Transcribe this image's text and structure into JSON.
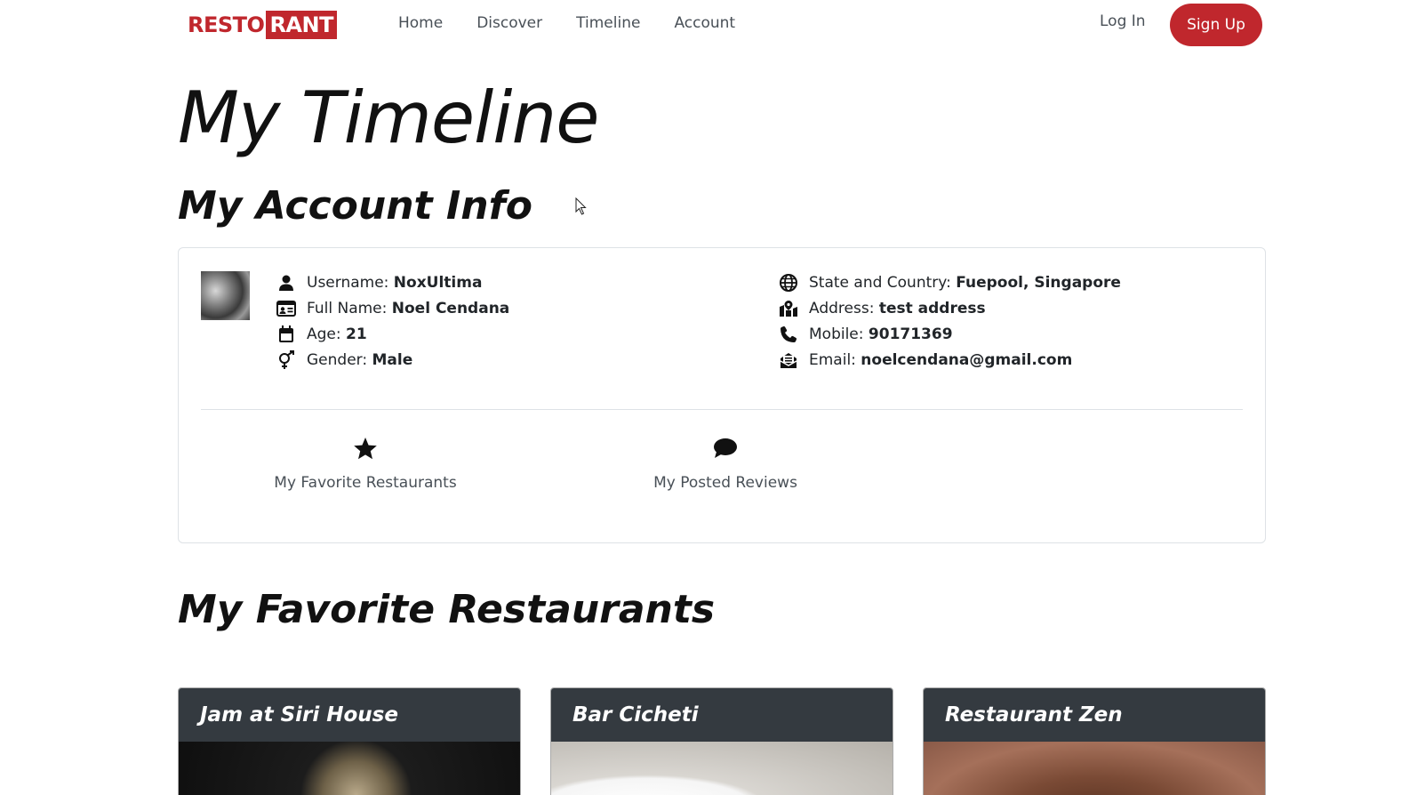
{
  "nav": {
    "logo_part1": "RESTO",
    "logo_part2": "RANT",
    "links": [
      "Home",
      "Discover",
      "Timeline",
      "Account"
    ],
    "login": "Log In",
    "signup": "Sign Up"
  },
  "page": {
    "title": "My Timeline",
    "account_section_title": "My Account Info",
    "favorites_section_title": "My Favorite Restaurants"
  },
  "account": {
    "left": [
      {
        "label": "Username: ",
        "value": "NoxUltima",
        "icon": "user-icon"
      },
      {
        "label": "Full Name: ",
        "value": "Noel Cendana",
        "icon": "id-card-icon"
      },
      {
        "label": "Age: ",
        "value": "21",
        "icon": "calendar-icon"
      },
      {
        "label": "Gender: ",
        "value": "Male",
        "icon": "gender-icon"
      }
    ],
    "right": [
      {
        "label": "State and Country: ",
        "value": "Fuepool, Singapore",
        "icon": "globe-icon"
      },
      {
        "label": "Address: ",
        "value": "test address",
        "icon": "map-location-icon"
      },
      {
        "label": "Mobile: ",
        "value": "90171369",
        "icon": "phone-icon"
      },
      {
        "label": "Email: ",
        "value": "noelcendana@gmail.com",
        "icon": "envelope-icon"
      }
    ],
    "actions": {
      "favorites": "My Favorite Restaurants",
      "reviews": "My Posted Reviews"
    }
  },
  "restaurants": [
    {
      "name": "Jam at Siri House"
    },
    {
      "name": "Bar Cicheti"
    },
    {
      "name": "Restaurant Zen"
    }
  ],
  "colors": {
    "brand": "#c0272d",
    "card_header": "#343a40"
  }
}
